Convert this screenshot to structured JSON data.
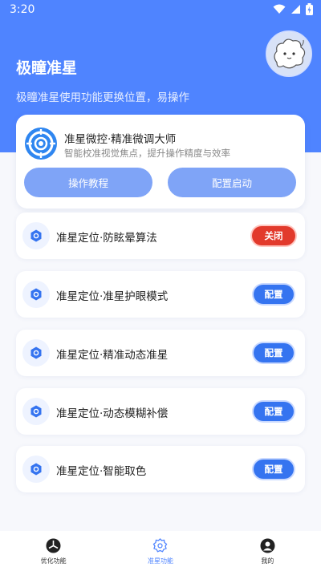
{
  "status": {
    "time": "3:20"
  },
  "header": {
    "title": "极瞳准星",
    "subtitle": "极瞳准星使用功能更换位置，易操作"
  },
  "top_card": {
    "title": "准星微控·精准微调大师",
    "desc": "智能校准视觉焦点，提升操作精度与效率",
    "tutorial_label": "操作教程",
    "start_label": "配置启动"
  },
  "features": [
    {
      "label": "准星定位·防眩晕算法",
      "button": "关闭"
    },
    {
      "label": "准星定位·准星护眼模式",
      "button": "配置"
    },
    {
      "label": "准星定位·精准动态准星",
      "button": "配置"
    },
    {
      "label": "准星定位·动态模糊补偿",
      "button": "配置"
    },
    {
      "label": "准星定位·智能取色",
      "button": "配置"
    }
  ],
  "nav": [
    {
      "label": "优化功能",
      "icon": "aperture-icon"
    },
    {
      "label": "准星功能",
      "icon": "crosshair-badge-icon"
    },
    {
      "label": "我的",
      "icon": "profile-icon"
    }
  ],
  "colors": {
    "primary": "#4f84ff",
    "button_blue": "#3574f0",
    "button_red": "#e23a2c",
    "light_button": "#7fa4f7"
  }
}
